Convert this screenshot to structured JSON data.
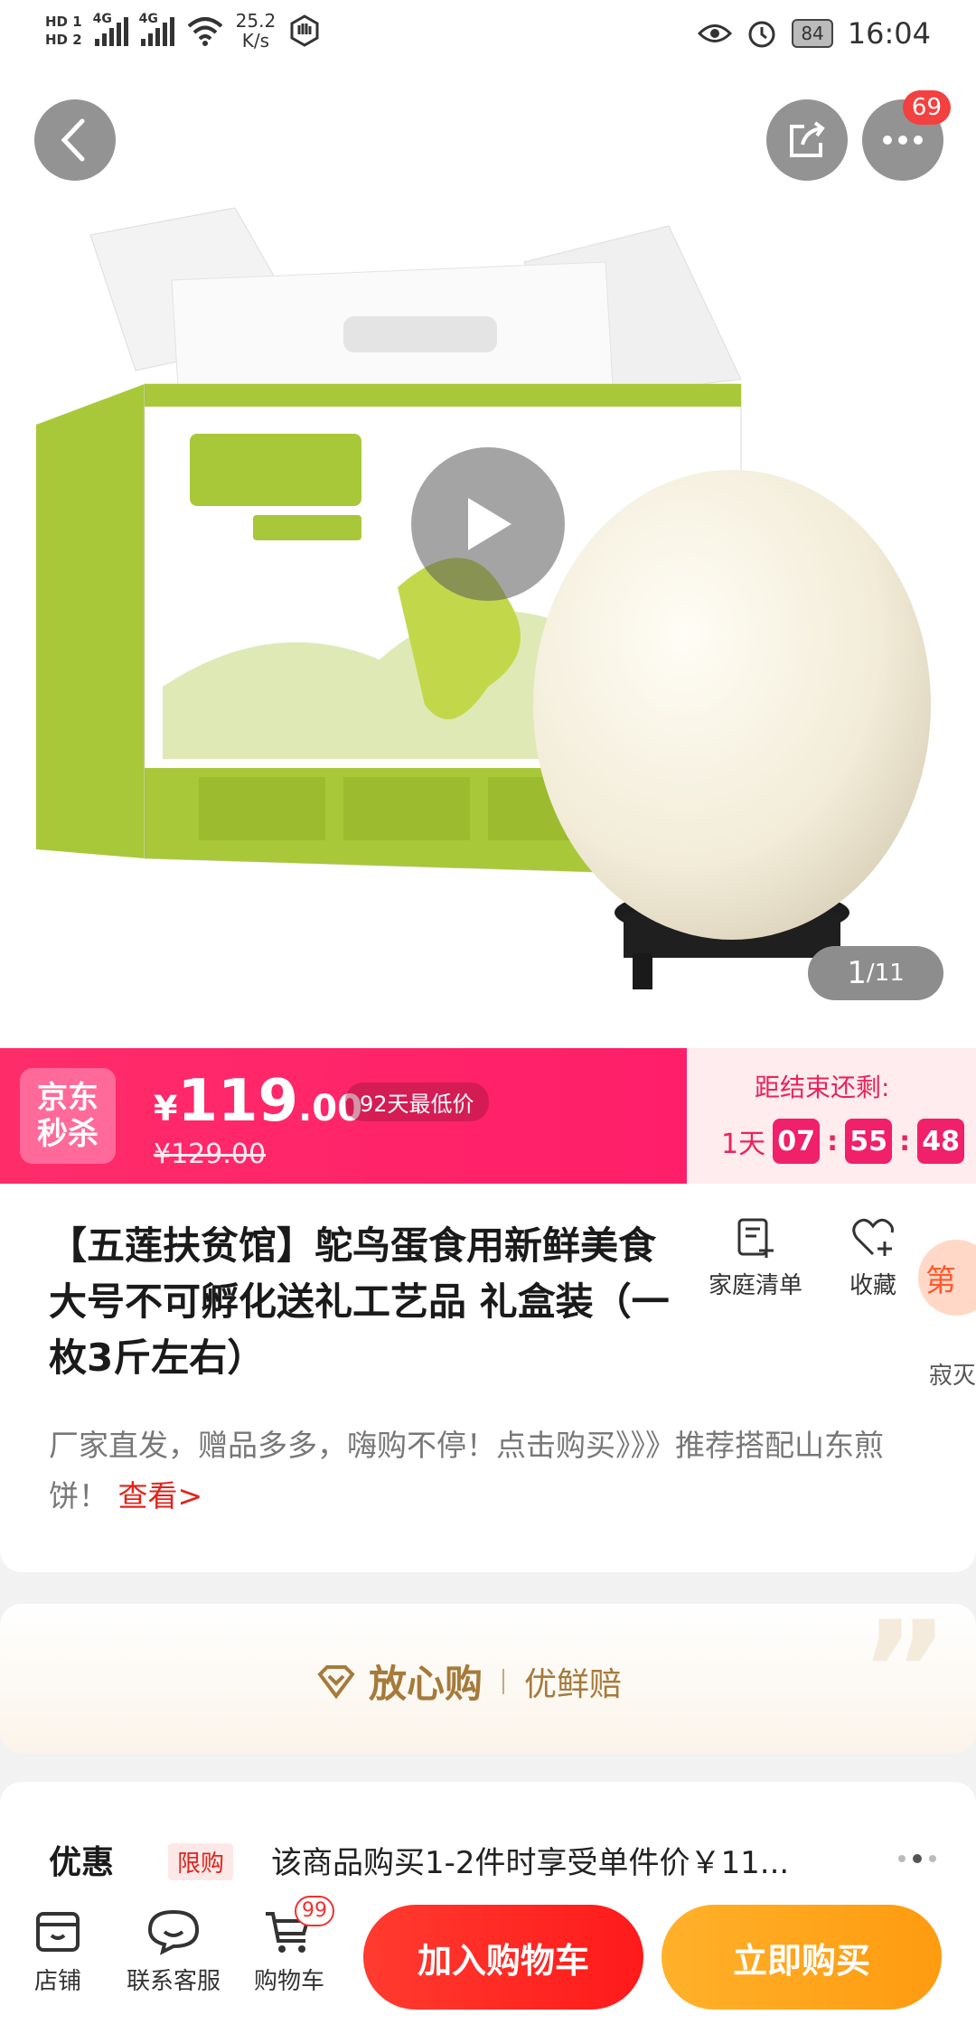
{
  "status_bar": {
    "hd1": "HD 1",
    "hd2": "HD 2",
    "net1": "4G",
    "net2": "4G",
    "speed_value": "25.2",
    "speed_unit": "K/s",
    "battery": "84",
    "time": "16:04"
  },
  "header": {
    "more_badge": "69"
  },
  "gallery": {
    "counter_current": "1",
    "counter_total": "/11"
  },
  "seckill": {
    "logo_line1": "京东",
    "logo_line2": "秒杀",
    "currency": "¥",
    "price_int": "119",
    "price_cents": ".00",
    "original_price": "¥129.00",
    "lowest_tag": "92天最低价",
    "ends_label": "距结束还剩:",
    "days": "1天",
    "hours": "07",
    "minutes": "55",
    "seconds": "48"
  },
  "product": {
    "title": "【五莲扶贫馆】鸵鸟蛋食用新鲜美食大号不可孵化送礼工艺品 礼盒装（一枚3斤左右）",
    "family_list_label": "家庭清单",
    "favorite_label": "收藏",
    "side_tab_char": "第",
    "side_tab_label": "寂灭",
    "subtitle": "厂家直发，赠品多多，嗨购不停！点击购买》》》推荐搭配山东煎饼！",
    "more_link": "查看>"
  },
  "guarantee": {
    "main": "放心购",
    "sub": "优鲜赔"
  },
  "promo": {
    "label": "优惠",
    "tag": "限购",
    "text": "该商品购买1-2件时享受单件价￥11..."
  },
  "bottom_bar": {
    "shop_label": "店铺",
    "service_label": "联系客服",
    "cart_label": "购物车",
    "cart_badge": "99",
    "add_to_cart": "加入购物车",
    "buy_now": "立即购买"
  }
}
